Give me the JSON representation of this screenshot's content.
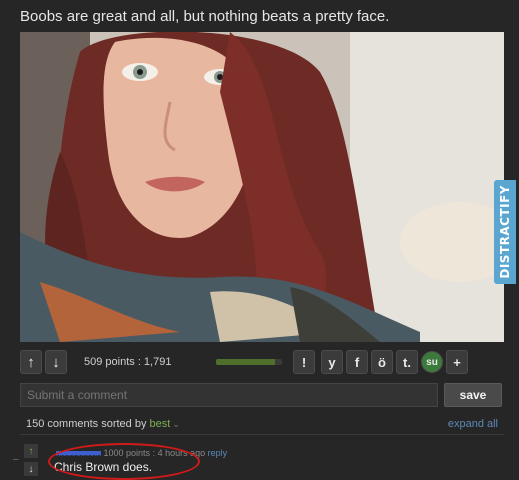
{
  "post": {
    "title": "Boobs are great and all, but nothing beats a pretty face.",
    "watermark": "DISTRACTIFY"
  },
  "toolbar": {
    "upvote_icon": "arrow-up-icon",
    "downvote_icon": "arrow-down-icon",
    "points_text": "509 points : 1,791",
    "points_bar_fraction": 0.9,
    "icons": [
      "exclamation-icon",
      "twitter-icon",
      "facebook-icon",
      "reddit-icon",
      "tumblr-icon",
      "stumbleupon-icon",
      "plus-icon"
    ],
    "exclamation": "!",
    "twitter": "y",
    "facebook": "f",
    "reddit": "ö",
    "tumblr": "t.",
    "stumbleupon": "su",
    "plus": "+"
  },
  "comment_box": {
    "placeholder": "Submit a comment",
    "save_label": "save"
  },
  "sort_bar": {
    "prefix": "150 comments sorted by ",
    "sort_value": "best",
    "expand_label": "expand all"
  },
  "comment": {
    "author": "xxxxxxxxxx",
    "points": "1000 points",
    "time": " : 4 hours ago",
    "reply_label": "reply",
    "text": "Chris Brown does."
  },
  "colors": {
    "background": "#262626",
    "accent_green": "#7fae53",
    "link_blue": "#5d88b7",
    "highlight_red": "#d11a1a",
    "watermark_blue": "#5aa6d0"
  }
}
